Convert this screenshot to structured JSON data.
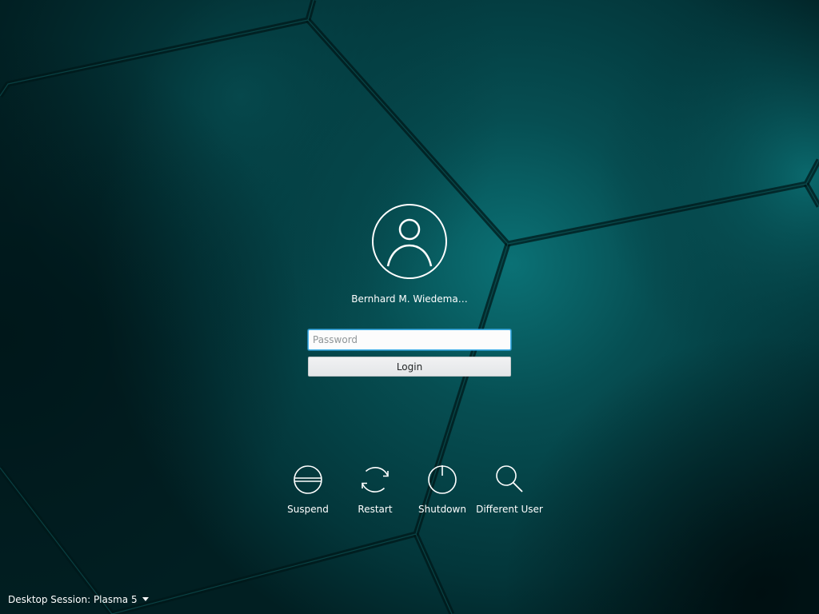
{
  "user": {
    "name": "Bernhard M. Wiedema…",
    "avatar_icon": "user-avatar-icon"
  },
  "login_form": {
    "password_placeholder": "Password",
    "password_value": "",
    "login_label": "Login"
  },
  "actions": [
    {
      "label": "Suspend",
      "icon": "suspend-icon"
    },
    {
      "label": "Restart",
      "icon": "restart-icon"
    },
    {
      "label": "Shutdown",
      "icon": "shutdown-icon"
    },
    {
      "label": "Different User",
      "icon": "search-icon"
    }
  ],
  "session": {
    "label": "Desktop Session: Plasma 5"
  },
  "colors": {
    "background_base": "#022a2c",
    "background_highlight": "#0a6a6c",
    "focus_accent": "#3daee9",
    "foreground": "#ffffff"
  }
}
